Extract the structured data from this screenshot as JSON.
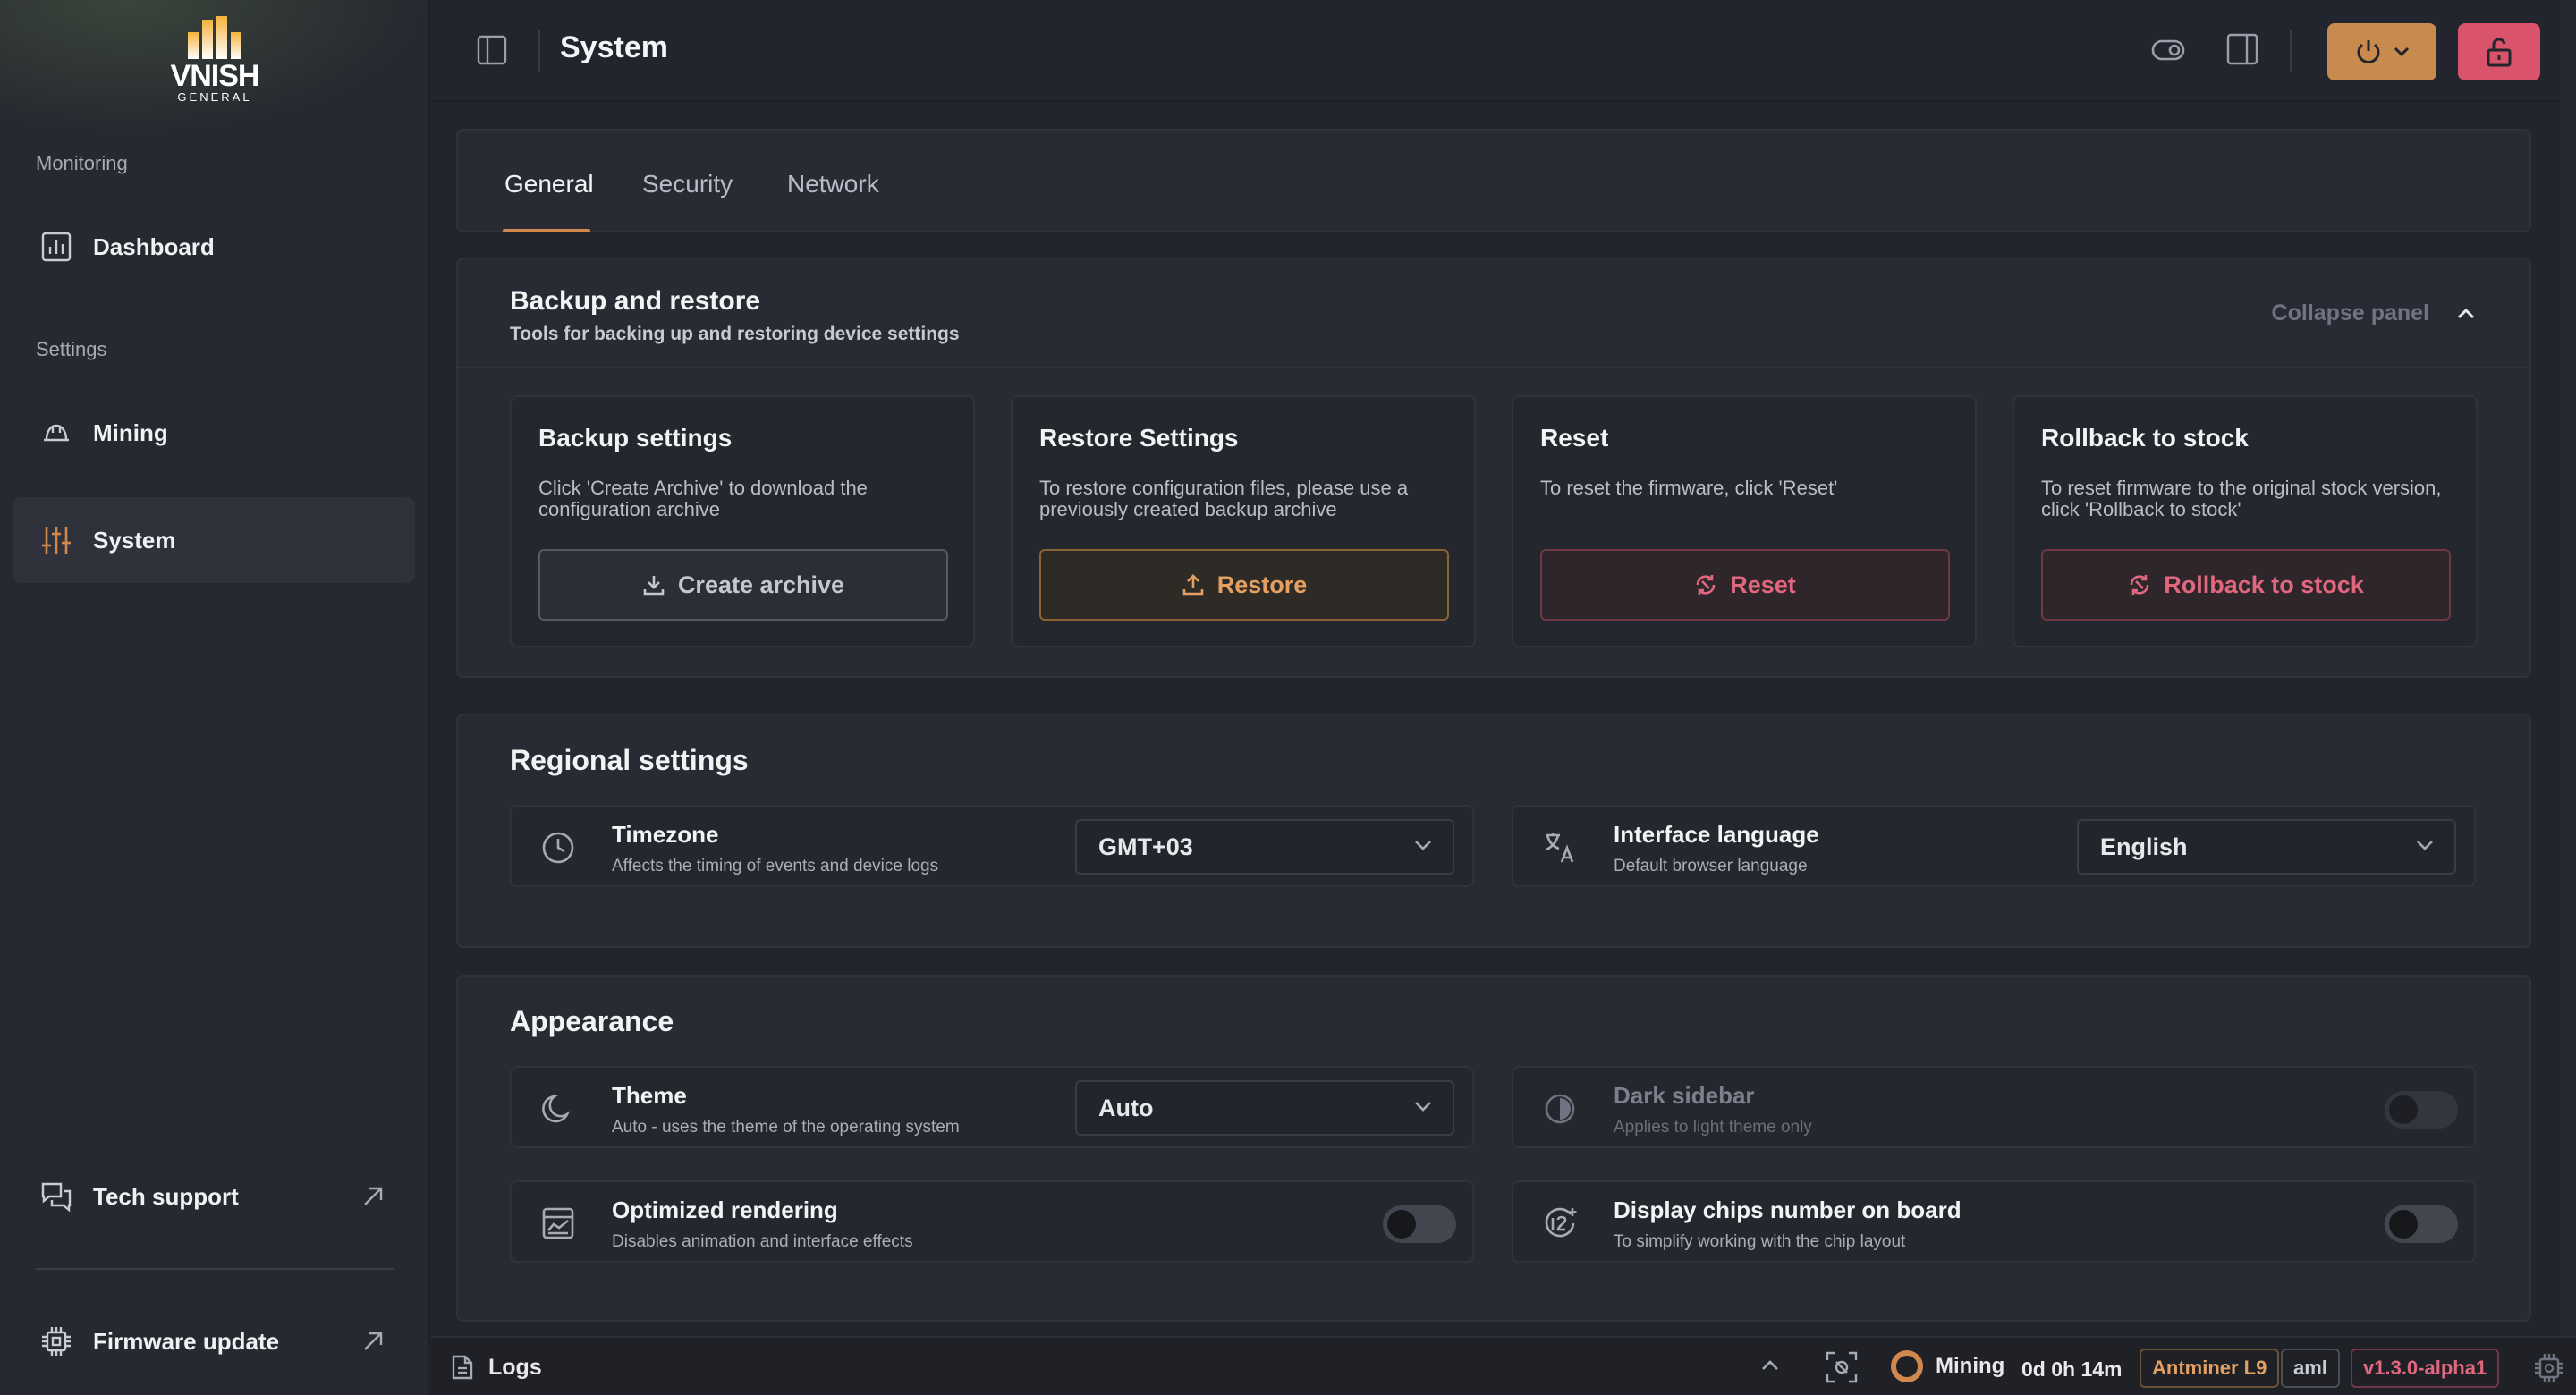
{
  "brand": {
    "name": "VNISH",
    "sub": "GENERAL"
  },
  "sidebar": {
    "sections": [
      {
        "label": "Monitoring"
      },
      {
        "label": "Settings"
      }
    ],
    "items": [
      {
        "label": "Dashboard",
        "icon": "chart-bar-icon"
      },
      {
        "label": "Mining",
        "icon": "hard-hat-icon"
      },
      {
        "label": "System",
        "icon": "sliders-icon",
        "active": true
      }
    ],
    "footer": [
      {
        "label": "Tech support",
        "icon": "chat-bubbles-icon"
      },
      {
        "label": "Firmware update",
        "icon": "chip-icon"
      }
    ]
  },
  "header": {
    "title": "System"
  },
  "tabs": [
    {
      "label": "General",
      "active": true
    },
    {
      "label": "Security"
    },
    {
      "label": "Network"
    }
  ],
  "backup": {
    "title": "Backup and restore",
    "subtitle": "Tools for backing up and restoring device settings",
    "collapse_label": "Collapse panel",
    "cards": [
      {
        "title": "Backup settings",
        "desc": "Click 'Create Archive' to download the configuration archive",
        "button": "Create archive"
      },
      {
        "title": "Restore Settings",
        "desc": "To restore configuration files, please use a previously created backup archive",
        "button": "Restore"
      },
      {
        "title": "Reset",
        "desc": "To reset the firmware, click 'Reset'",
        "button": "Reset"
      },
      {
        "title": "Rollback to stock",
        "desc": "To reset firmware to the original stock version, click 'Rollback to stock'",
        "button": "Rollback to stock"
      }
    ]
  },
  "regional": {
    "title": "Regional settings",
    "timezone": {
      "name": "Timezone",
      "desc": "Affects the timing of events and device logs",
      "value": "GMT+03"
    },
    "language": {
      "name": "Interface language",
      "desc": "Default browser language",
      "value": "English"
    }
  },
  "appearance": {
    "title": "Appearance",
    "theme": {
      "name": "Theme",
      "desc": "Auto - uses the theme of the operating system",
      "value": "Auto"
    },
    "dark_sidebar": {
      "name": "Dark sidebar",
      "desc": "Applies to light theme only",
      "enabled": false
    },
    "optimized": {
      "name": "Optimized rendering",
      "desc": "Disables animation and interface effects",
      "enabled": false
    },
    "chips": {
      "name": "Display chips number on board",
      "desc": "To simplify working with the chip layout",
      "enabled": false
    }
  },
  "statusbar": {
    "logs": "Logs",
    "state": "Mining",
    "uptime": "0d 0h 14m",
    "model": "Antminer L9",
    "platform": "aml",
    "version": "v1.3.0-alpha1"
  },
  "colors": {
    "accent": "#d2874f",
    "danger": "#d9536a",
    "bg": "#22252d",
    "sidebar": "#262930"
  }
}
